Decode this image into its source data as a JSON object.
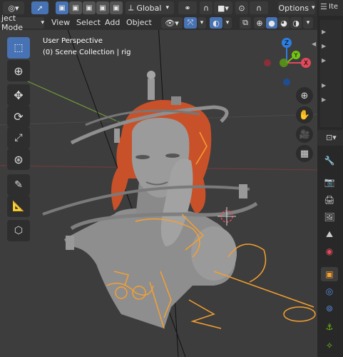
{
  "header": {
    "transform_orientation": "Global",
    "options_label": "Options",
    "partial_right_label": "Ite"
  },
  "menubar": {
    "mode_label": "ject Mode",
    "items": [
      "View",
      "Select",
      "Add",
      "Object"
    ]
  },
  "viewport": {
    "perspective_label": "User Perspective",
    "collection_label": "(0) Scene Collection | rig"
  },
  "gizmo": {
    "z_label": "Z",
    "y_label": "Y",
    "x_label": "X"
  },
  "colors": {
    "viewport_bg": "#3d3d3d",
    "selection_orange": "#f5a030",
    "active_blue": "#4772b3",
    "axis_red": "#e04a5a",
    "axis_green": "#74c414",
    "axis_blue": "#2f7ee0",
    "hair": "#c8512a"
  }
}
